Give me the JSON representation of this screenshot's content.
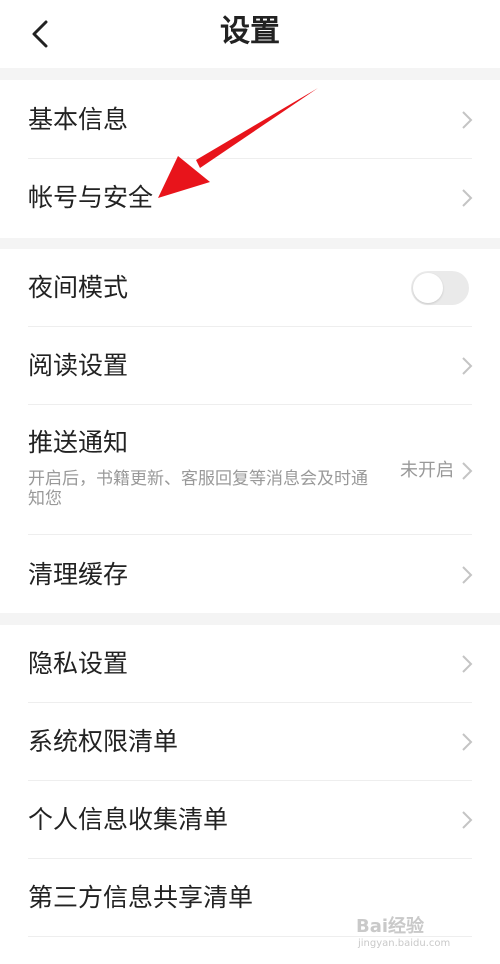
{
  "header": {
    "title": "设置",
    "back_icon": "chevron-left-icon"
  },
  "section1": {
    "items": [
      {
        "label": "基本信息"
      },
      {
        "label": "帐号与安全"
      }
    ]
  },
  "section2": {
    "night_mode": {
      "label": "夜间模式",
      "enabled": false
    },
    "reading": {
      "label": "阅读设置"
    },
    "push": {
      "label": "推送通知",
      "sublabel": "开启后，书籍更新、客服回复等消息会及时通知您",
      "status": "未开启"
    },
    "cache": {
      "label": "清理缓存"
    }
  },
  "section3": {
    "items": [
      {
        "label": "隐私设置"
      },
      {
        "label": "系统权限清单"
      },
      {
        "label": "个人信息收集清单"
      },
      {
        "label": "第三方信息共享清单"
      }
    ]
  },
  "annotation": {
    "arrow_color": "#e8141b"
  },
  "watermark": {
    "logo": "Bai经验",
    "site": "jingyan.baidu.com"
  }
}
